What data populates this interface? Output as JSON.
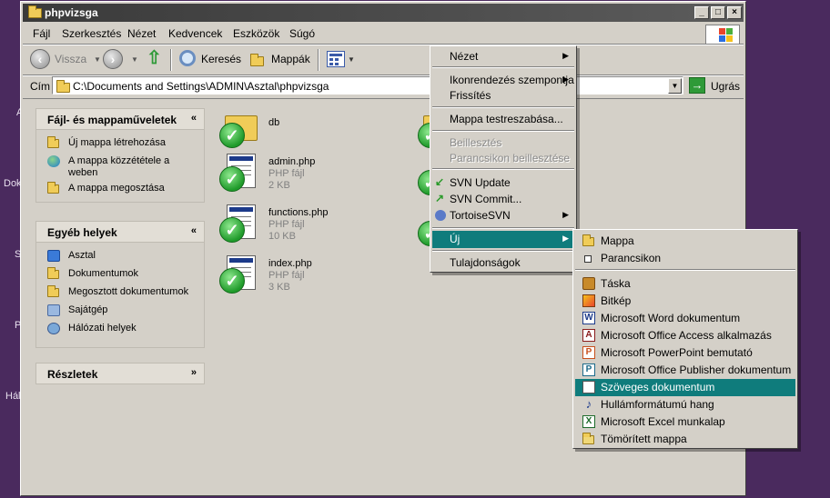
{
  "desktop": {
    "labels": [
      "A",
      "Dok",
      "S",
      "P",
      "Hál"
    ]
  },
  "window": {
    "title": "phpvizsga",
    "controls": [
      "minimize-icon",
      "maximize-icon",
      "close-icon"
    ]
  },
  "menubar": [
    "Fájl",
    "Szerkesztés",
    "Nézet",
    "Kedvencek",
    "Eszközök",
    "Súgó"
  ],
  "toolbar": {
    "back": "Vissza",
    "search": "Keresés",
    "folders": "Mappák"
  },
  "address": {
    "label": "Cím",
    "path": "C:\\Documents and Settings\\ADMIN\\Asztal\\phpvizsga",
    "go": "Ugrás"
  },
  "tasks": {
    "title": "Fájl- és mappaműveletek",
    "items": [
      {
        "line1": "Új mappa létrehozása",
        "line2": ""
      },
      {
        "line1": "A mappa közzététele a",
        "line2": "weben"
      },
      {
        "line1": "A mappa megosztása",
        "line2": ""
      }
    ]
  },
  "places": {
    "title": "Egyéb helyek",
    "items": [
      "Asztal",
      "Dokumentumok",
      "Megosztott dokumentumok",
      "Sajátgép",
      "Hálózati helyek"
    ]
  },
  "details": {
    "title": "Részletek"
  },
  "files": [
    {
      "name": "db",
      "type": "",
      "size": ""
    },
    {
      "name": "admin.php",
      "type": "PHP fájl",
      "size": "2 KB"
    },
    {
      "name": "functions.php",
      "type": "PHP fájl",
      "size": "10 KB"
    },
    {
      "name": "index.php",
      "type": "PHP fájl",
      "size": "3 KB"
    }
  ],
  "context_menu": {
    "items": [
      {
        "label": "Nézet"
      },
      {
        "label": "Ikonrendezés szempontja"
      },
      {
        "label": "Frissítés"
      },
      {
        "label": "Mappa testreszabása..."
      },
      {
        "label": "Beillesztés"
      },
      {
        "label": "Parancsikon beillesztése"
      },
      {
        "label": "SVN Update"
      },
      {
        "label": "SVN Commit..."
      },
      {
        "label": "TortoiseSVN"
      },
      {
        "label": "Új"
      },
      {
        "label": "Tulajdonságok"
      }
    ]
  },
  "new_submenu": {
    "items": [
      {
        "label": "Mappa"
      },
      {
        "label": "Parancsikon"
      },
      {
        "label": "Táska"
      },
      {
        "label": "Bitkép"
      },
      {
        "label": "Microsoft Word dokumentum"
      },
      {
        "label": "Microsoft Office Access alkalmazás"
      },
      {
        "label": "Microsoft PowerPoint bemutató"
      },
      {
        "label": "Microsoft Office Publisher dokumentum"
      },
      {
        "label": "Szöveges dokumentum"
      },
      {
        "label": "Hullámformátumú hang"
      },
      {
        "label": "Microsoft Excel munkalap"
      },
      {
        "label": "Tömörített mappa"
      }
    ]
  },
  "colors": {
    "selection": "#0f7c7c",
    "face": "#d4d0c8",
    "desktop": "#4a2a5e"
  }
}
